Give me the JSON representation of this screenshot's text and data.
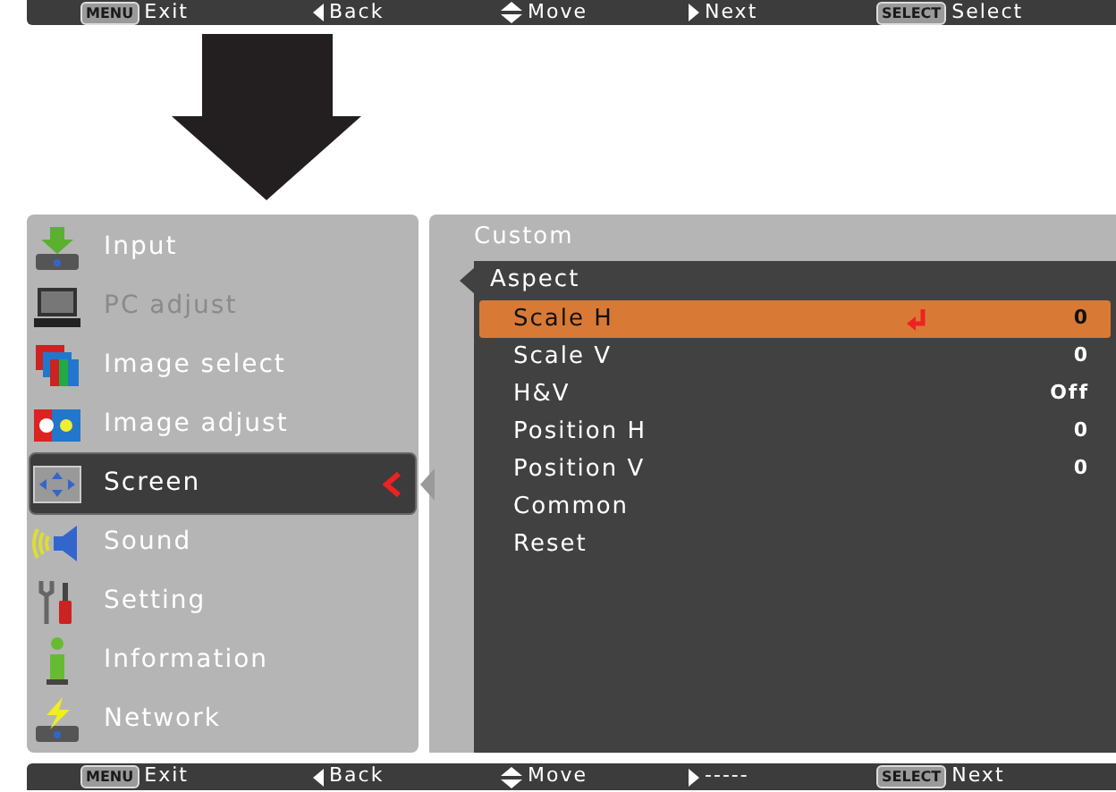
{
  "top_guide_bar": [
    {
      "key": "MENU",
      "label": "Exit",
      "kind": "key"
    },
    {
      "label": "Back",
      "kind": "left"
    },
    {
      "label": "Move",
      "kind": "updown"
    },
    {
      "label": "Next",
      "kind": "right"
    },
    {
      "key": "SELECT",
      "label": "Select",
      "kind": "key"
    }
  ],
  "main_menu": [
    {
      "label": "Input",
      "selected": false,
      "disabled": false
    },
    {
      "label": "PC adjust",
      "selected": false,
      "disabled": true
    },
    {
      "label": "Image select",
      "selected": false,
      "disabled": false
    },
    {
      "label": "Image adjust",
      "selected": false,
      "disabled": false
    },
    {
      "label": "Screen",
      "selected": true,
      "disabled": false
    },
    {
      "label": "Sound",
      "selected": false,
      "disabled": false
    },
    {
      "label": "Setting",
      "selected": false,
      "disabled": false
    },
    {
      "label": "Information",
      "selected": false,
      "disabled": false
    },
    {
      "label": "Network",
      "selected": false,
      "disabled": false
    }
  ],
  "submenu": {
    "title": "Custom",
    "header": "Aspect",
    "items": [
      {
        "label": "Scale H",
        "value": "0",
        "selected": true
      },
      {
        "label": "Scale V",
        "value": "0",
        "selected": false
      },
      {
        "label": "H&V",
        "value": "Off",
        "selected": false
      },
      {
        "label": "Position H",
        "value": "0",
        "selected": false
      },
      {
        "label": "Position V",
        "value": "0",
        "selected": false
      },
      {
        "label": "Common",
        "selected": false
      },
      {
        "label": "Reset",
        "selected": false
      }
    ]
  },
  "bottom_guide_bar": [
    {
      "key": "MENU",
      "label": "Exit",
      "kind": "key"
    },
    {
      "label": "Back",
      "kind": "left"
    },
    {
      "label": "Move",
      "kind": "updown"
    },
    {
      "label": "-----",
      "kind": "right"
    },
    {
      "key": "SELECT",
      "label": "Next",
      "kind": "key"
    }
  ]
}
